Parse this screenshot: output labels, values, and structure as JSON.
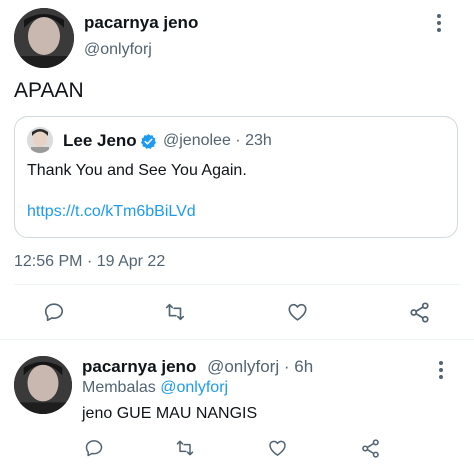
{
  "tweet": {
    "author_name": "pacarnya jeno",
    "author_handle": "@onlyforj",
    "text": "APAAN",
    "timestamp": "12:56 PM",
    "date": "19 Apr 22",
    "separator": "·"
  },
  "quoted": {
    "author_name": "Lee Jeno",
    "author_handle": "@jenolee",
    "separator": "·",
    "time": "23h",
    "text": "Thank You and See You Again.",
    "link": "https://t.co/kTm6bBiLVd"
  },
  "reply": {
    "author_name": "pacarnya jeno",
    "author_handle": "@onlyforj",
    "separator": "·",
    "time": "6h",
    "replying_label": "Membalas",
    "replying_to": "@onlyforj",
    "text": "jeno GUE MAU NANGIS"
  },
  "icons": [
    "more-icon",
    "verified-icon",
    "reply-icon",
    "retweet-icon",
    "like-icon",
    "share-icon"
  ],
  "colors": {
    "accent": "#1d9bf0",
    "muted": "#536471",
    "text": "#0f1419",
    "border": "#cfd9de"
  }
}
